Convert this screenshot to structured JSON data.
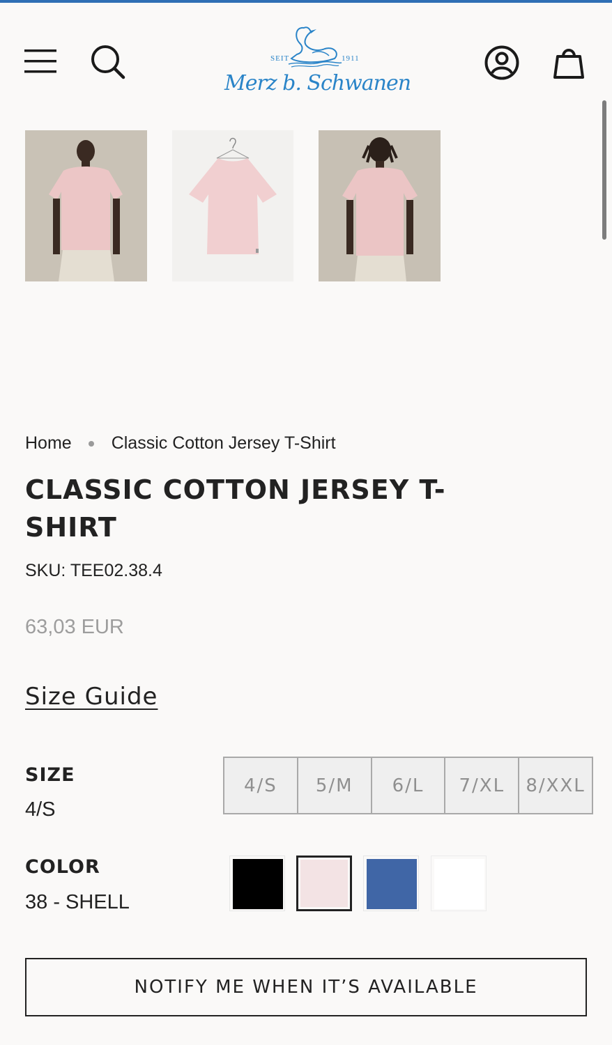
{
  "header": {
    "logo": {
      "seit": "SEIT",
      "year": "1911",
      "script": "Merz b. Schwanen"
    },
    "icons": [
      "menu-icon",
      "search-icon",
      "account-icon",
      "cart-icon"
    ]
  },
  "gallery": {
    "images": [
      {
        "label": "model-front"
      },
      {
        "label": "flat-hanger"
      },
      {
        "label": "model-back"
      }
    ]
  },
  "breadcrumb": {
    "home": "Home",
    "current": "Classic Cotton Jersey T-Shirt"
  },
  "product": {
    "title": "CLASSIC COTTON JERSEY T-SHIRT",
    "sku": "SKU: TEE02.38.4",
    "price": "63,03 EUR",
    "size_guide": "Size Guide"
  },
  "options": {
    "size": {
      "label": "SIZE",
      "selected": "4/S",
      "values": [
        "4/S",
        "5/M",
        "6/L",
        "7/XL",
        "8/XXL"
      ]
    },
    "color": {
      "label": "COLOR",
      "selected": "38 - SHELL",
      "swatches": [
        "#000000",
        "#f3e3e4",
        "#4066a6",
        "#ffffff"
      ]
    }
  },
  "cta": {
    "notify_label": "NOTIFY ME WHEN IT’S AVAILABLE"
  },
  "colors": {
    "accent": "#2f6fb5",
    "logo_blue": "#2a84c8",
    "muted_price": "#9d9d9d"
  }
}
